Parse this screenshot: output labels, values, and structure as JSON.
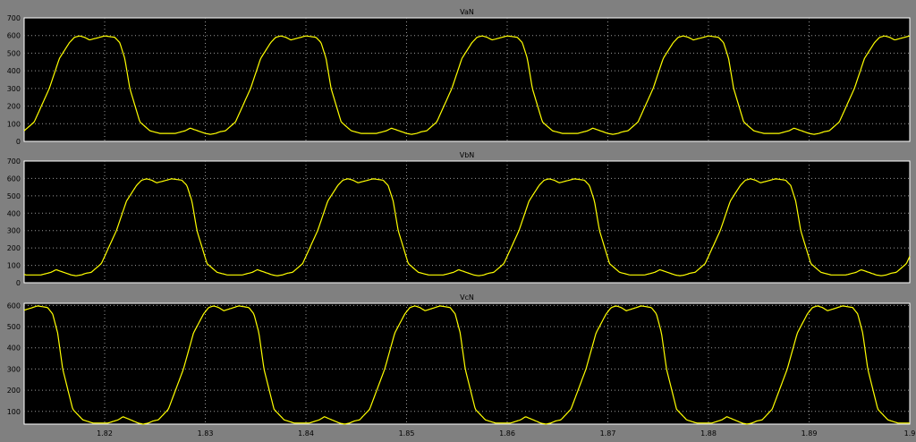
{
  "chart_data": [
    {
      "type": "line",
      "title": "VaN",
      "xlim": [
        1.812,
        1.9
      ],
      "ylim": [
        0,
        700
      ],
      "yticks": [
        0,
        100,
        200,
        300,
        400,
        500,
        600,
        700
      ],
      "xticks": [
        1.82,
        1.83,
        1.84,
        1.85,
        1.86,
        1.87,
        1.88,
        1.89,
        1.9
      ],
      "show_x_tick_labels": false,
      "grid": true,
      "period": 0.02,
      "phase_shift": 0.0,
      "series": [
        {
          "color": "#ffff00",
          "x": [
            1.812,
            1.813,
            1.8145,
            1.8155,
            1.8165,
            1.817,
            1.8175,
            1.818,
            1.8185,
            1.8195,
            1.82,
            1.821,
            1.8215,
            1.822,
            1.8225,
            1.8235,
            1.8245,
            1.8255,
            1.827,
            1.828,
            1.8285,
            1.8295,
            1.83,
            1.8305,
            1.831,
            1.8315,
            1.832
          ],
          "y": [
            60,
            110,
            300,
            470,
            560,
            590,
            598,
            590,
            575,
            590,
            598,
            590,
            560,
            470,
            300,
            110,
            60,
            45,
            45,
            60,
            75,
            55,
            45,
            40,
            45,
            55,
            60
          ]
        }
      ]
    },
    {
      "type": "line",
      "title": "VbN",
      "xlim": [
        1.812,
        1.9
      ],
      "ylim": [
        0,
        700
      ],
      "yticks": [
        0,
        100,
        200,
        300,
        400,
        500,
        600,
        700
      ],
      "xticks": [
        1.82,
        1.83,
        1.84,
        1.85,
        1.86,
        1.87,
        1.88,
        1.89,
        1.9
      ],
      "show_x_tick_labels": false,
      "grid": true,
      "period": 0.02,
      "phase_shift": 0.00667,
      "series": [
        {
          "color": "#ffff00",
          "x": [],
          "y": []
        }
      ]
    },
    {
      "type": "line",
      "title": "VcN",
      "xlim": [
        1.812,
        1.9
      ],
      "ylim": [
        40,
        610
      ],
      "yticks": [
        100,
        200,
        300,
        400,
        500,
        600
      ],
      "xticks": [
        1.82,
        1.83,
        1.84,
        1.85,
        1.86,
        1.87,
        1.88,
        1.89,
        1.9
      ],
      "xticklabels": [
        "1.82",
        "1.83",
        "1.84",
        "1.85",
        "1.86",
        "1.87",
        "1.88",
        "1.89",
        "1.9"
      ],
      "show_x_tick_labels": true,
      "grid": true,
      "period": 0.02,
      "phase_shift": 0.01333,
      "series": [
        {
          "color": "#ffff00",
          "x": [],
          "y": []
        }
      ]
    }
  ]
}
